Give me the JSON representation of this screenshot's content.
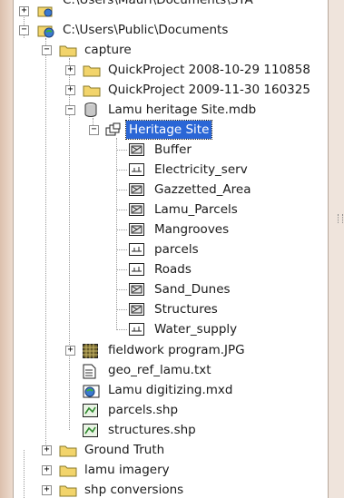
{
  "colors": {
    "panel_bg": "#ffffff",
    "selection": "#2a66d6",
    "frame": "#e8d3c3",
    "folder": "#f2d46b"
  },
  "tree": {
    "users_path": "C:\\Users\\Mauri\\Documents\\STA",
    "public_docs": "C:\\Users\\Public\\Documents",
    "capture": "capture",
    "qp1": "QuickProject 2008-10-29 110858",
    "qp2": "QuickProject 2009-11-30 160325",
    "mdb": "Lamu heritage Site.mdb",
    "dataset": "Heritage Site",
    "layers": [
      {
        "label": "Buffer",
        "icon": "polygon-feature-class-icon"
      },
      {
        "label": "Electricity_serv",
        "icon": "line-feature-class-icon"
      },
      {
        "label": "Gazzetted_Area",
        "icon": "polygon-feature-class-icon"
      },
      {
        "label": "Lamu_Parcels",
        "icon": "polygon-feature-class-icon"
      },
      {
        "label": "Mangrooves",
        "icon": "polygon-feature-class-icon"
      },
      {
        "label": "parcels",
        "icon": "line-feature-class-icon"
      },
      {
        "label": "Roads",
        "icon": "line-feature-class-icon"
      },
      {
        "label": "Sand_Dunes",
        "icon": "polygon-feature-class-icon"
      },
      {
        "label": "Structures",
        "icon": "polygon-feature-class-icon"
      },
      {
        "label": "Water_supply",
        "icon": "line-feature-class-icon"
      }
    ],
    "files": [
      {
        "label": "fieldwork program.JPG",
        "icon": "raster-image-icon"
      },
      {
        "label": "geo_ref_lamu.txt",
        "icon": "text-file-icon"
      },
      {
        "label": "Lamu digitizing.mxd",
        "icon": "map-document-icon"
      },
      {
        "label": "parcels.shp",
        "icon": "shapefile-icon"
      },
      {
        "label": "structures.shp",
        "icon": "shapefile-icon"
      }
    ],
    "folders": [
      "Ground Truth",
      "lamu imagery",
      "shp conversions"
    ]
  }
}
